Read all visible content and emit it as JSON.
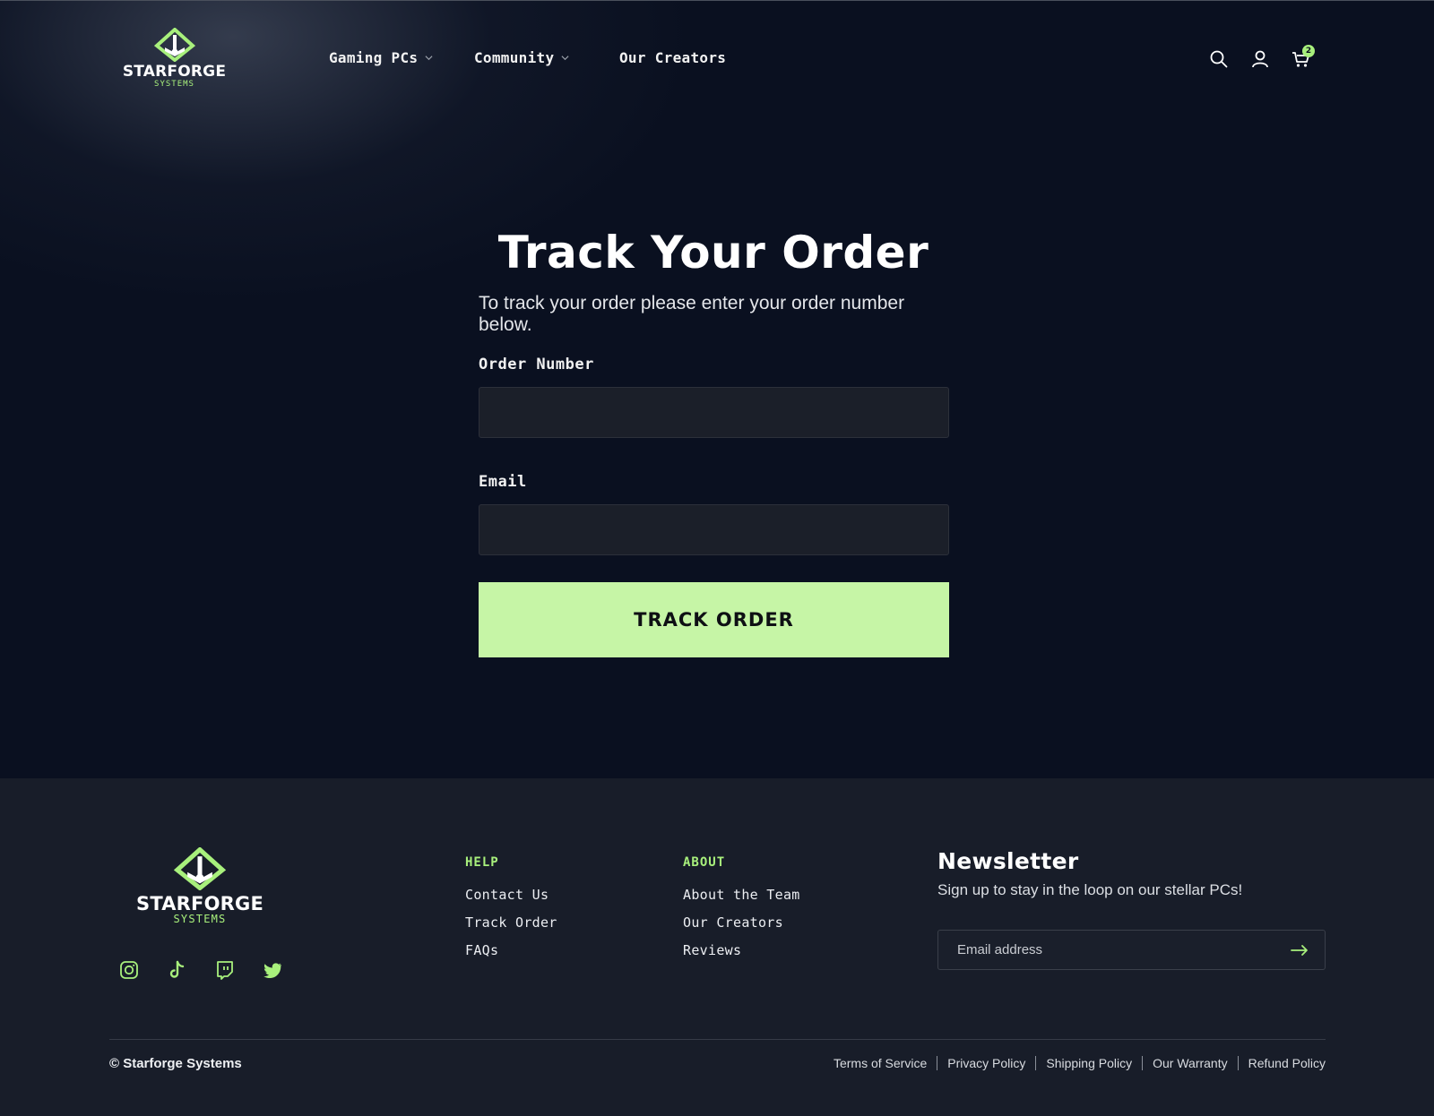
{
  "header": {
    "logo": {
      "wordmark": "STARFORGE",
      "tagline": "SYSTEMS"
    },
    "nav": [
      {
        "label": "Gaming PCs",
        "has_dropdown": true
      },
      {
        "label": "Community",
        "has_dropdown": true
      },
      {
        "label": "Our Creators",
        "has_dropdown": false
      }
    ],
    "icons": [
      "search-icon",
      "account-icon",
      "cart-icon"
    ],
    "cart_count": "2"
  },
  "main": {
    "title": "Track Your Order",
    "subtitle": "To track your order please enter your order number below.",
    "order_number_label": "Order Number",
    "order_number_value": "",
    "email_label": "Email",
    "email_value": "",
    "button_label": "TRACK ORDER"
  },
  "footer": {
    "logo": {
      "wordmark": "STARFORGE",
      "tagline": "SYSTEMS"
    },
    "socials": [
      "instagram-icon",
      "tiktok-icon",
      "twitch-icon",
      "twitter-icon"
    ],
    "help": {
      "heading": "HELP",
      "links": [
        "Contact Us",
        "Track Order",
        "FAQs"
      ]
    },
    "about": {
      "heading": "ABOUT",
      "links": [
        "About the Team",
        "Our Creators",
        "Reviews"
      ]
    },
    "newsletter": {
      "title": "Newsletter",
      "subtitle": "Sign up to stay in the loop on our stellar PCs!",
      "placeholder": "Email address"
    },
    "copyright": "© Starforge Systems",
    "legal": [
      "Terms of Service",
      "Privacy Policy",
      "Shipping Policy",
      "Our Warranty",
      "Refund Policy"
    ]
  },
  "colors": {
    "background": "#0a1020",
    "footer_background": "#181d29",
    "accent": "#a8f07c",
    "button": "#c6f5a6",
    "field": "#1b1f29"
  }
}
